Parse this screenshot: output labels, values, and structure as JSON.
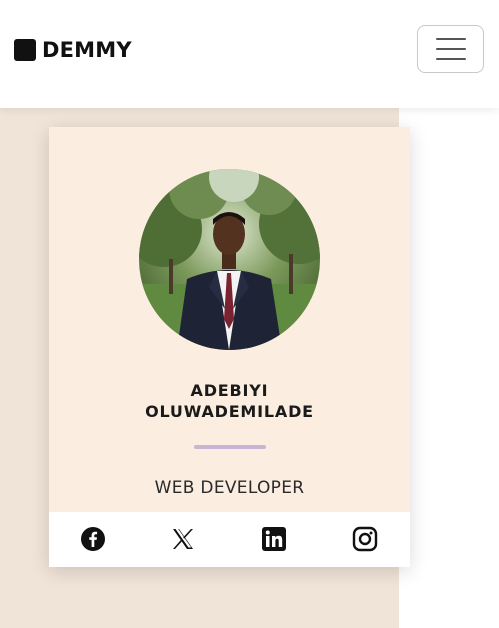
{
  "navbar": {
    "brand": "DEMMY",
    "menu_icon": "hamburger-icon"
  },
  "profile": {
    "name_line1": "ADEBIYI",
    "name_line2": "OLUWADEMILADE",
    "role": "WEB DEVELOPER",
    "avatar": "profile-photo"
  },
  "social": {
    "icons": [
      "facebook-icon",
      "x-icon",
      "linkedin-icon",
      "instagram-icon"
    ]
  },
  "colors": {
    "page_panel": "#f0e3d7",
    "card": "#fbede0",
    "divider": "#c6b6d3",
    "text": "#1a1a1a"
  }
}
